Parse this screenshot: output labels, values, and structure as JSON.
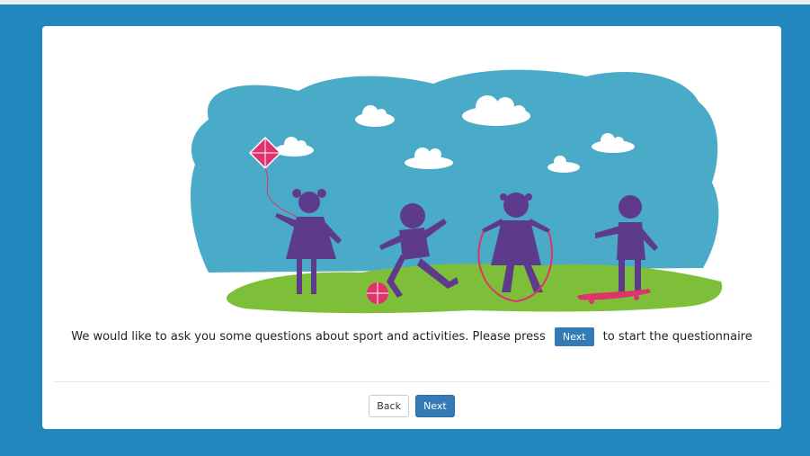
{
  "intro": {
    "text_before": "We would like to ask you some questions about sport and activities. Please press",
    "inline_button_label": "Next",
    "text_after": "to start the questionnaire"
  },
  "nav": {
    "back_label": "Back",
    "next_label": "Next"
  },
  "footer": {
    "dots": ". ."
  },
  "colors": {
    "page_background": "#2187bd",
    "sky": "#4aabc9",
    "grass": "#7ebf3a",
    "children": "#5e3a8c",
    "accent_pink": "#e0326b",
    "primary_button": "#337ab7"
  },
  "icons": [
    "kite-icon",
    "ball-icon",
    "skateboard-icon",
    "jump-rope-icon",
    "cloud-icon"
  ]
}
